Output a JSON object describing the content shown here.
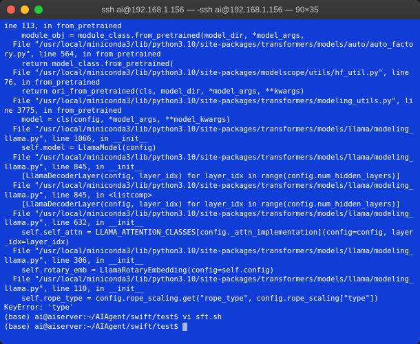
{
  "window": {
    "title": "ssh ai@192.168.1.156 — -ssh ai@192.168.1.156 — 90×35"
  },
  "terminal": {
    "lines": [
      "ine 113, in from_pretrained",
      "    module_obj = module_class.from_pretrained(model_dir, *model_args,",
      "  File \"/usr/local/miniconda3/lib/python3.10/site-packages/transformers/models/auto/auto_factory.py\", line 564, in from_pretrained",
      "    return model_class.from_pretrained(",
      "  File \"/usr/local/miniconda3/lib/python3.10/site-packages/modelscope/utils/hf_util.py\", line 76, in from_pretrained",
      "    return ori_from_pretrained(cls, model_dir, *model_args, **kwargs)",
      "  File \"/usr/local/miniconda3/lib/python3.10/site-packages/transformers/modeling_utils.py\", line 3775, in from_pretrained",
      "    model = cls(config, *model_args, **model_kwargs)",
      "  File \"/usr/local/miniconda3/lib/python3.10/site-packages/transformers/models/llama/modeling_llama.py\", line 1066, in __init__",
      "    self.model = LlamaModel(config)",
      "  File \"/usr/local/miniconda3/lib/python3.10/site-packages/transformers/models/llama/modeling_llama.py\", line 845, in __init__",
      "    [LlamaDecoderLayer(config, layer_idx) for layer_idx in range(config.num_hidden_layers)]",
      "  File \"/usr/local/miniconda3/lib/python3.10/site-packages/transformers/models/llama/modeling_llama.py\", line 845, in <listcomp>",
      "    [LlamaDecoderLayer(config, layer_idx) for layer_idx in range(config.num_hidden_layers)]",
      "  File \"/usr/local/miniconda3/lib/python3.10/site-packages/transformers/models/llama/modeling_llama.py\", line 632, in __init__",
      "    self.self_attn = LLAMA_ATTENTION_CLASSES[config._attn_implementation](config=config, layer_idx=layer_idx)",
      "  File \"/usr/local/miniconda3/lib/python3.10/site-packages/transformers/models/llama/modeling_llama.py\", line 306, in __init__",
      "    self.rotary_emb = LlamaRotaryEmbedding(config=self.config)",
      "  File \"/usr/local/miniconda3/lib/python3.10/site-packages/transformers/models/llama/modeling_llama.py\", line 110, in __init__",
      "    self.rope_type = config.rope_scaling.get(\"rope_type\", config.rope_scaling[\"type\"])",
      "KeyError: 'type'"
    ],
    "prompt1": "(base) ai@aiserver:~/AIAgent/swift/test$ ",
    "command1": "vi sft.sh",
    "prompt2": "(base) ai@aiserver:~/AIAgent/swift/test$ "
  }
}
